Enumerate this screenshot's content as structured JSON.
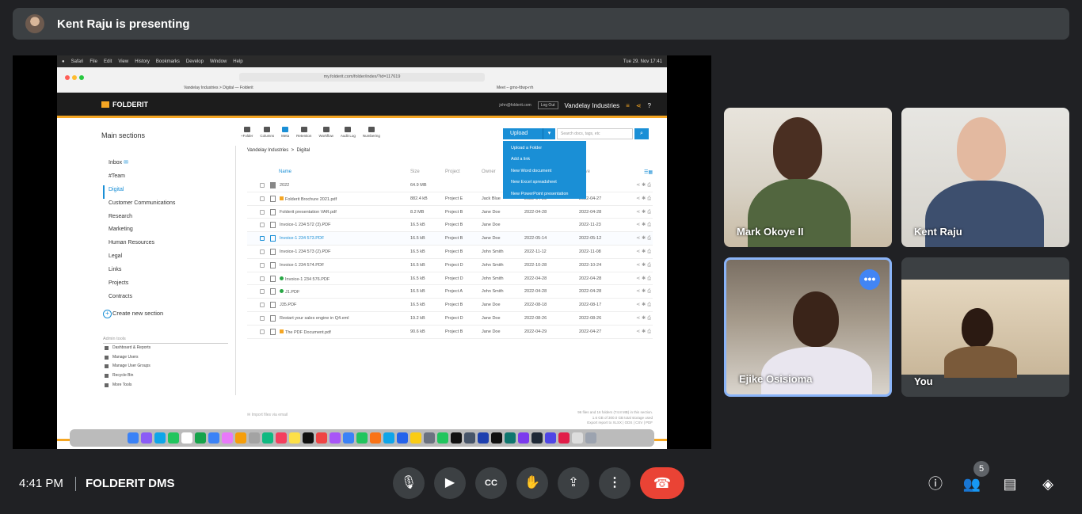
{
  "presenter": {
    "text": "Kent Raju is presenting"
  },
  "screen": {
    "mac_menu": [
      "Safari",
      "File",
      "Edit",
      "View",
      "History",
      "Bookmarks",
      "Develop",
      "Window",
      "Help"
    ],
    "clock": "Tue 29. Nov 17:41",
    "url": "my.folderit.com/folder/index/?id=117619",
    "tab1": "Vandelay Industries > Digital — Folderit",
    "tab2": "Meet – gmo-fdwp-rrh",
    "logo": "FOLDERIT",
    "user_email": "john@folderit.com",
    "logout": "Log Out",
    "org": "Vandelay Industries",
    "main_sections": "Main sections",
    "tools": [
      "+Folder",
      "Columns",
      "Meta",
      "Retention",
      "Workflow",
      "Audit Log",
      "Numbering"
    ],
    "upload": "Upload",
    "search_placeholder": "Search docs, tags, etc",
    "upload_menu": [
      "Upload a Folder",
      "Add a link",
      "New Word document",
      "New Excel spreadsheet",
      "New PowerPoint presentation"
    ],
    "sections": [
      "Inbox",
      "#Team",
      "Digital",
      "Customer Communications",
      "Research",
      "Marketing",
      "Human Resources",
      "Legal",
      "Links",
      "Projects",
      "Contracts"
    ],
    "create_section": "Create new section",
    "admin_tools": "Admin tools",
    "admin_items": [
      "Dashboard & Reports",
      "Manage Users",
      "Manage User Groups",
      "Recycle Bin",
      "More Tools"
    ],
    "breadcrumb": [
      "Vandelay Industries",
      "Digital"
    ],
    "columns": [
      "Name",
      "Size",
      "Project",
      "Owner",
      "",
      "Live"
    ],
    "rows": [
      {
        "name": "2022",
        "size": "64.9 MB",
        "project": "",
        "owner": "",
        "d1": "",
        "d2": ""
      },
      {
        "name": "Folderit Brochure 2021.pdf",
        "size": "882.4 kB",
        "project": "Project E",
        "owner": "Jack Blue",
        "d1": "2022-04-28",
        "d2": "2022-04-27"
      },
      {
        "name": "Folderit presentation VAR.pdf",
        "size": "8.2 MB",
        "project": "Project B",
        "owner": "Jane Doe",
        "d1": "2022-04-28",
        "d2": "2022-04-28"
      },
      {
        "name": "Invoice-1 234 572 (3).PDF",
        "size": "16.5 kB",
        "project": "Project B",
        "owner": "Jane Doe",
        "d1": "",
        "d2": "2022-11-23"
      },
      {
        "name": "Invoice-1 234 573.PDF",
        "size": "16.5 kB",
        "project": "Project B",
        "owner": "Jane Doe",
        "d1": "2022-05-14",
        "d2": "2022-05-12"
      },
      {
        "name": "Invoice-1 234 573 (2).PDF",
        "size": "16.5 kB",
        "project": "Project B",
        "owner": "John Smith",
        "d1": "2022-11-12",
        "d2": "2022-11-08"
      },
      {
        "name": "Invoice-1 234 574.PDF",
        "size": "16.5 kB",
        "project": "Project D",
        "owner": "John Smith",
        "d1": "2022-10-28",
        "d2": "2022-10-24"
      },
      {
        "name": "Invoice-1 234 576.PDF",
        "size": "16.5 kB",
        "project": "Project D",
        "owner": "John Smith",
        "d1": "2022-04-28",
        "d2": "2022-04-28"
      },
      {
        "name": "J1.PDF",
        "size": "16.5 kB",
        "project": "Project A",
        "owner": "John Smith",
        "d1": "2022-04-28",
        "d2": "2022-04-28"
      },
      {
        "name": "J35.PDF",
        "size": "16.5 kB",
        "project": "Project B",
        "owner": "Jane Doe",
        "d1": "2022-08-18",
        "d2": "2022-08-17"
      },
      {
        "name": "Restart your sales engine in Q4.eml",
        "size": "19.2 kB",
        "project": "Project D",
        "owner": "Jane Doe",
        "d1": "2022-08-26",
        "d2": "2022-08-26"
      },
      {
        "name": "The PDF Document.pdf",
        "size": "90.6 kB",
        "project": "Project B",
        "owner": "Jane Doe",
        "d1": "2022-04-29",
        "d2": "2022-04-27"
      }
    ],
    "import_via_email": "Import files via email",
    "footer_info": [
      "96 files and 16 folders (74.8 MB) in this section.",
      "1.6 GB of 300.0 GB total storage used",
      "Export report to XLSX | ODS | CSV | PDF"
    ]
  },
  "participants": [
    {
      "name": "Mark Okoye II"
    },
    {
      "name": "Kent Raju"
    },
    {
      "name": "Ejike Osisioma"
    },
    {
      "name": "You"
    }
  ],
  "controls": {
    "time": "4:41 PM",
    "meeting_name": "FOLDERIT DMS",
    "people_count": "5"
  }
}
